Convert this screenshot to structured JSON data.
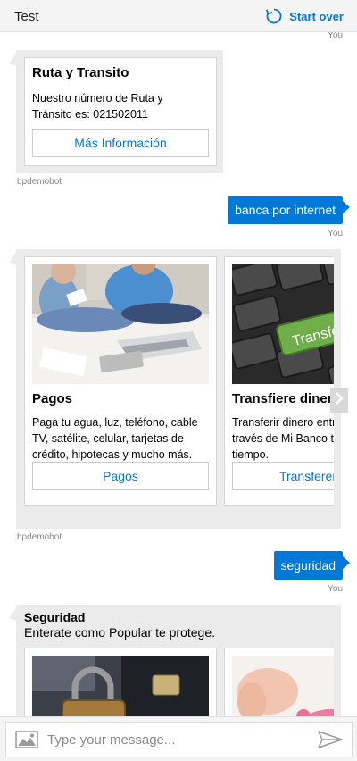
{
  "header": {
    "title": "Test",
    "restart_label": "Start over"
  },
  "conversation": {
    "you_label": "You",
    "bot_name": "bpdemobot",
    "routing_card": {
      "title": "Ruta y Transito",
      "text": "Nuestro número de Ruta y Tránsito es: 021502011",
      "button": "Más Información"
    },
    "user_message_1": "banca por internet",
    "carousel_1": {
      "cards": [
        {
          "title": "Pagos",
          "text": "Paga tu agua, luz, teléfono, cable TV, satélite, celular, tarjetas de crédito, hipotecas y mucho más.",
          "button": "Pagos"
        },
        {
          "title": "Transfiere dinero",
          "text": "Transferir dinero entre cuentas a través de Mi Banco te ahorra tiempo.",
          "button": "Transferencias",
          "image_text": "Transfer"
        }
      ]
    },
    "user_message_2": "seguridad",
    "security_message": {
      "title": "Seguridad",
      "subtitle": "Enterate como Popular te protege."
    }
  },
  "input": {
    "placeholder": "Type your message..."
  },
  "colors": {
    "accent": "#0078d7",
    "bubble_gray": "#ebebeb",
    "header_bg": "#f4f4f4"
  }
}
